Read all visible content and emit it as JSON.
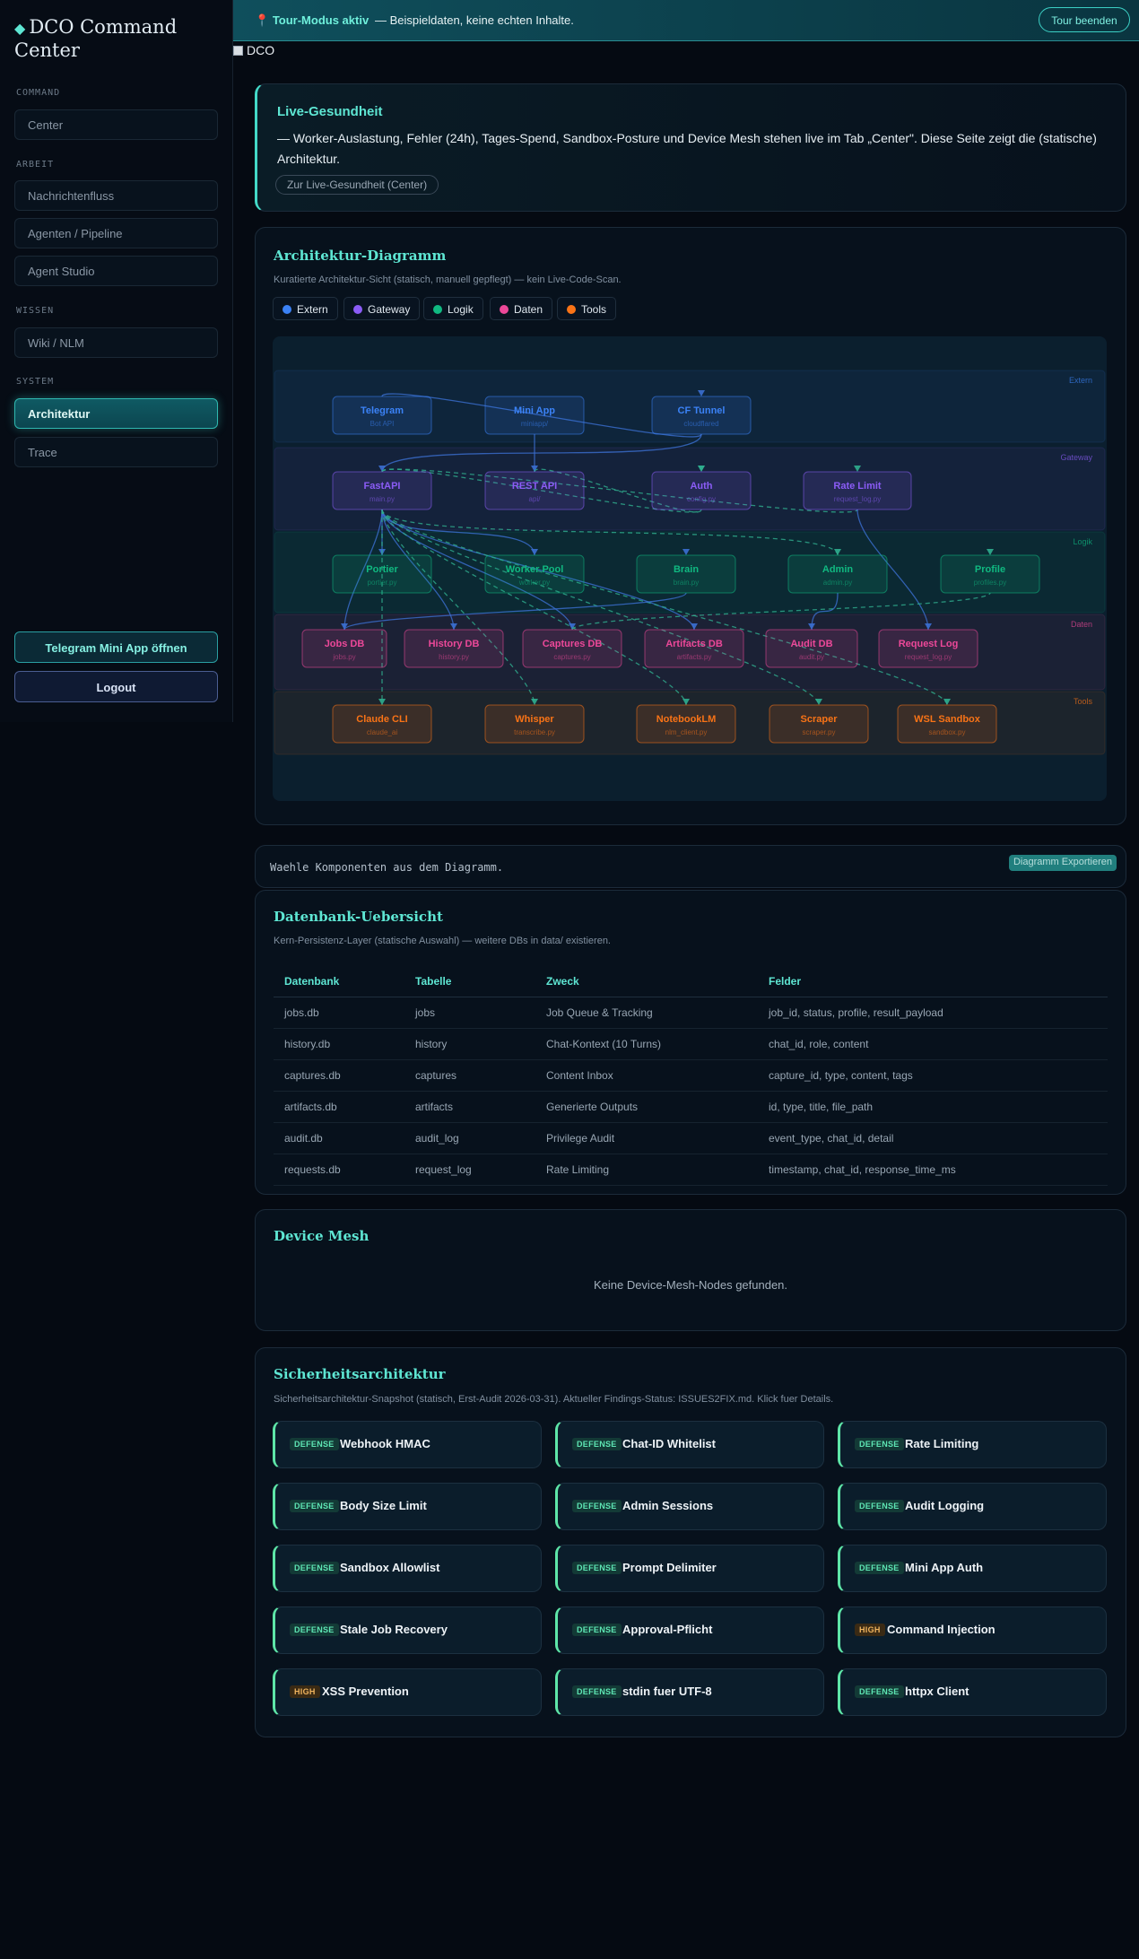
{
  "sidebar": {
    "brand": "DCO Command Center",
    "sections": [
      {
        "title": "COMMAND",
        "items": [
          "Center"
        ]
      },
      {
        "title": "ARBEIT",
        "items": [
          "Nachrichtenfluss",
          "Agenten / Pipeline",
          "Agent Studio"
        ]
      },
      {
        "title": "WISSEN",
        "items": [
          "Wiki / NLM"
        ]
      },
      {
        "title": "SYSTEM",
        "items": [
          "Architektur",
          "Trace"
        ]
      }
    ],
    "active_item": "Architektur",
    "telegram_button": "Telegram Mini App öffnen",
    "logout_button": "Logout"
  },
  "tour": {
    "label": "Tour-Modus aktiv",
    "text": "— Beispieldaten, keine echten Inhalte.",
    "end_button": "Tour beenden"
  },
  "app_label": "DCO",
  "live": {
    "title": "Live-Gesundheit",
    "description": "— Worker-Auslastung, Fehler (24h), Tages-Spend, Sandbox-Posture und Device Mesh stehen live im Tab „Center\". Diese Seite zeigt die (statische) Architektur.",
    "link": "Zur Live-Gesundheit (Center)"
  },
  "architecture": {
    "title": "Architektur-Diagramm",
    "subtitle": "Kuratierte Architektur-Sicht (statisch, manuell gepflegt) — kein Live-Code-Scan.",
    "legend": [
      {
        "label": "Extern",
        "color": "#3b82f6"
      },
      {
        "label": "Gateway",
        "color": "#8b5cf6"
      },
      {
        "label": "Logik",
        "color": "#10b981"
      },
      {
        "label": "Daten",
        "color": "#ec4899"
      },
      {
        "label": "Tools",
        "color": "#f97316"
      }
    ],
    "layers": [
      "Extern",
      "Gateway",
      "Logik",
      "Daten",
      "Tools"
    ],
    "nodes": [
      {
        "id": "telegram",
        "layer": "Extern",
        "label": "Telegram",
        "sub": "Bot API"
      },
      {
        "id": "miniapp",
        "layer": "Extern",
        "label": "Mini App",
        "sub": "miniapp/"
      },
      {
        "id": "cftunnel",
        "layer": "Extern",
        "label": "CF Tunnel",
        "sub": "cloudflared"
      },
      {
        "id": "fastapi",
        "layer": "Gateway",
        "label": "FastAPI",
        "sub": "main.py"
      },
      {
        "id": "restapi",
        "layer": "Gateway",
        "label": "REST API",
        "sub": "api/"
      },
      {
        "id": "auth",
        "layer": "Gateway",
        "label": "Auth",
        "sub": "config.py"
      },
      {
        "id": "ratelimit",
        "layer": "Gateway",
        "label": "Rate Limit",
        "sub": "request_log.py"
      },
      {
        "id": "portier",
        "layer": "Logik",
        "label": "Portier",
        "sub": "portier.py"
      },
      {
        "id": "workerpool",
        "layer": "Logik",
        "label": "Worker Pool",
        "sub": "worker.py"
      },
      {
        "id": "brain",
        "layer": "Logik",
        "label": "Brain",
        "sub": "brain.py"
      },
      {
        "id": "admin",
        "layer": "Logik",
        "label": "Admin",
        "sub": "admin.py"
      },
      {
        "id": "profile",
        "layer": "Logik",
        "label": "Profile",
        "sub": "profiles.py"
      },
      {
        "id": "jobsdb",
        "layer": "Daten",
        "label": "Jobs DB",
        "sub": "jobs.py"
      },
      {
        "id": "historydb",
        "layer": "Daten",
        "label": "History DB",
        "sub": "history.py"
      },
      {
        "id": "capturesdb",
        "layer": "Daten",
        "label": "Captures DB",
        "sub": "captures.py"
      },
      {
        "id": "artifactsdb",
        "layer": "Daten",
        "label": "Artifacts DB",
        "sub": "artifacts.py"
      },
      {
        "id": "auditdb",
        "layer": "Daten",
        "label": "Audit DB",
        "sub": "audit.py"
      },
      {
        "id": "requestlog",
        "layer": "Daten",
        "label": "Request Log",
        "sub": "request_log.py"
      },
      {
        "id": "claudecli",
        "layer": "Tools",
        "label": "Claude CLI",
        "sub": "claude_ai"
      },
      {
        "id": "whisper",
        "layer": "Tools",
        "label": "Whisper",
        "sub": "transcribe.py"
      },
      {
        "id": "notebooklm",
        "layer": "Tools",
        "label": "NotebookLM",
        "sub": "nlm_client.py"
      },
      {
        "id": "scraper",
        "layer": "Tools",
        "label": "Scraper",
        "sub": "scraper.py"
      },
      {
        "id": "wslsandbox",
        "layer": "Tools",
        "label": "WSL Sandbox",
        "sub": "sandbox.py"
      }
    ],
    "edges": [
      {
        "from": "telegram",
        "to": "cftunnel",
        "dashed": false
      },
      {
        "from": "cftunnel",
        "to": "fastapi",
        "dashed": false
      },
      {
        "from": "miniapp",
        "to": "restapi",
        "dashed": false
      },
      {
        "from": "fastapi",
        "to": "auth",
        "dashed": true
      },
      {
        "from": "fastapi",
        "to": "ratelimit",
        "dashed": true
      },
      {
        "from": "fastapi",
        "to": "portier",
        "dashed": false
      },
      {
        "from": "fastapi",
        "to": "workerpool",
        "dashed": false
      },
      {
        "from": "fastapi",
        "to": "admin",
        "dashed": true
      },
      {
        "from": "fastapi",
        "to": "jobsdb",
        "dashed": false
      },
      {
        "from": "fastapi",
        "to": "historydb",
        "dashed": false
      },
      {
        "from": "fastapi",
        "to": "capturesdb",
        "dashed": false
      },
      {
        "from": "fastapi",
        "to": "artifactsdb",
        "dashed": false
      },
      {
        "from": "fastapi",
        "to": "claudecli",
        "dashed": true
      },
      {
        "from": "fastapi",
        "to": "whisper",
        "dashed": true
      },
      {
        "from": "fastapi",
        "to": "notebooklm",
        "dashed": true
      },
      {
        "from": "fastapi",
        "to": "scraper",
        "dashed": true
      },
      {
        "from": "fastapi",
        "to": "wslsandbox",
        "dashed": true
      },
      {
        "from": "restapi",
        "to": "auth",
        "dashed": true
      },
      {
        "from": "admin",
        "to": "auditdb",
        "dashed": false
      },
      {
        "from": "ratelimit",
        "to": "requestlog",
        "dashed": false
      },
      {
        "from": "capturesdb",
        "to": "profile",
        "dashed": true
      },
      {
        "from": "jobsdb",
        "to": "brain",
        "dashed": false
      }
    ],
    "details_message": "Waehle Komponenten aus dem Diagramm.",
    "export_button": "Diagramm Exportieren"
  },
  "databases": {
    "title": "Datenbank-Uebersicht",
    "subtitle": "Kern-Persistenz-Layer (statische Auswahl) — weitere DBs in data/ existieren.",
    "columns": [
      "Datenbank",
      "Tabelle",
      "Zweck",
      "Felder"
    ],
    "rows": [
      [
        "jobs.db",
        "jobs",
        "Job Queue & Tracking",
        "job_id, status, profile, result_payload"
      ],
      [
        "history.db",
        "history",
        "Chat-Kontext (10 Turns)",
        "chat_id, role, content"
      ],
      [
        "captures.db",
        "captures",
        "Content Inbox",
        "capture_id, type, content, tags"
      ],
      [
        "artifacts.db",
        "artifacts",
        "Generierte Outputs",
        "id, type, title, file_path"
      ],
      [
        "audit.db",
        "audit_log",
        "Privilege Audit",
        "event_type, chat_id, detail"
      ],
      [
        "requests.db",
        "request_log",
        "Rate Limiting",
        "timestamp, chat_id, response_time_ms"
      ]
    ]
  },
  "mesh": {
    "title": "Device Mesh",
    "empty": "Keine Device-Mesh-Nodes gefunden."
  },
  "security": {
    "title": "Sicherheitsarchitektur",
    "subtitle": "Sicherheitsarchitektur-Snapshot (statisch, Erst-Audit 2026-03-31). Aktueller Findings-Status: ISSUES2FIX.md. Klick fuer Details.",
    "items": [
      {
        "badge": "DEFENSE",
        "name": "Webhook HMAC"
      },
      {
        "badge": "DEFENSE",
        "name": "Chat-ID Whitelist"
      },
      {
        "badge": "DEFENSE",
        "name": "Rate Limiting"
      },
      {
        "badge": "DEFENSE",
        "name": "Body Size Limit"
      },
      {
        "badge": "DEFENSE",
        "name": "Admin Sessions"
      },
      {
        "badge": "DEFENSE",
        "name": "Audit Logging"
      },
      {
        "badge": "DEFENSE",
        "name": "Sandbox Allowlist"
      },
      {
        "badge": "DEFENSE",
        "name": "Prompt Delimiter"
      },
      {
        "badge": "DEFENSE",
        "name": "Mini App Auth"
      },
      {
        "badge": "DEFENSE",
        "name": "Stale Job Recovery"
      },
      {
        "badge": "DEFENSE",
        "name": "Approval-Pflicht"
      },
      {
        "badge": "HIGH",
        "name": "Command Injection"
      },
      {
        "badge": "HIGH",
        "name": "XSS Prevention"
      },
      {
        "badge": "DEFENSE",
        "name": "stdin fuer UTF-8"
      },
      {
        "badge": "DEFENSE",
        "name": "httpx Client"
      }
    ]
  }
}
